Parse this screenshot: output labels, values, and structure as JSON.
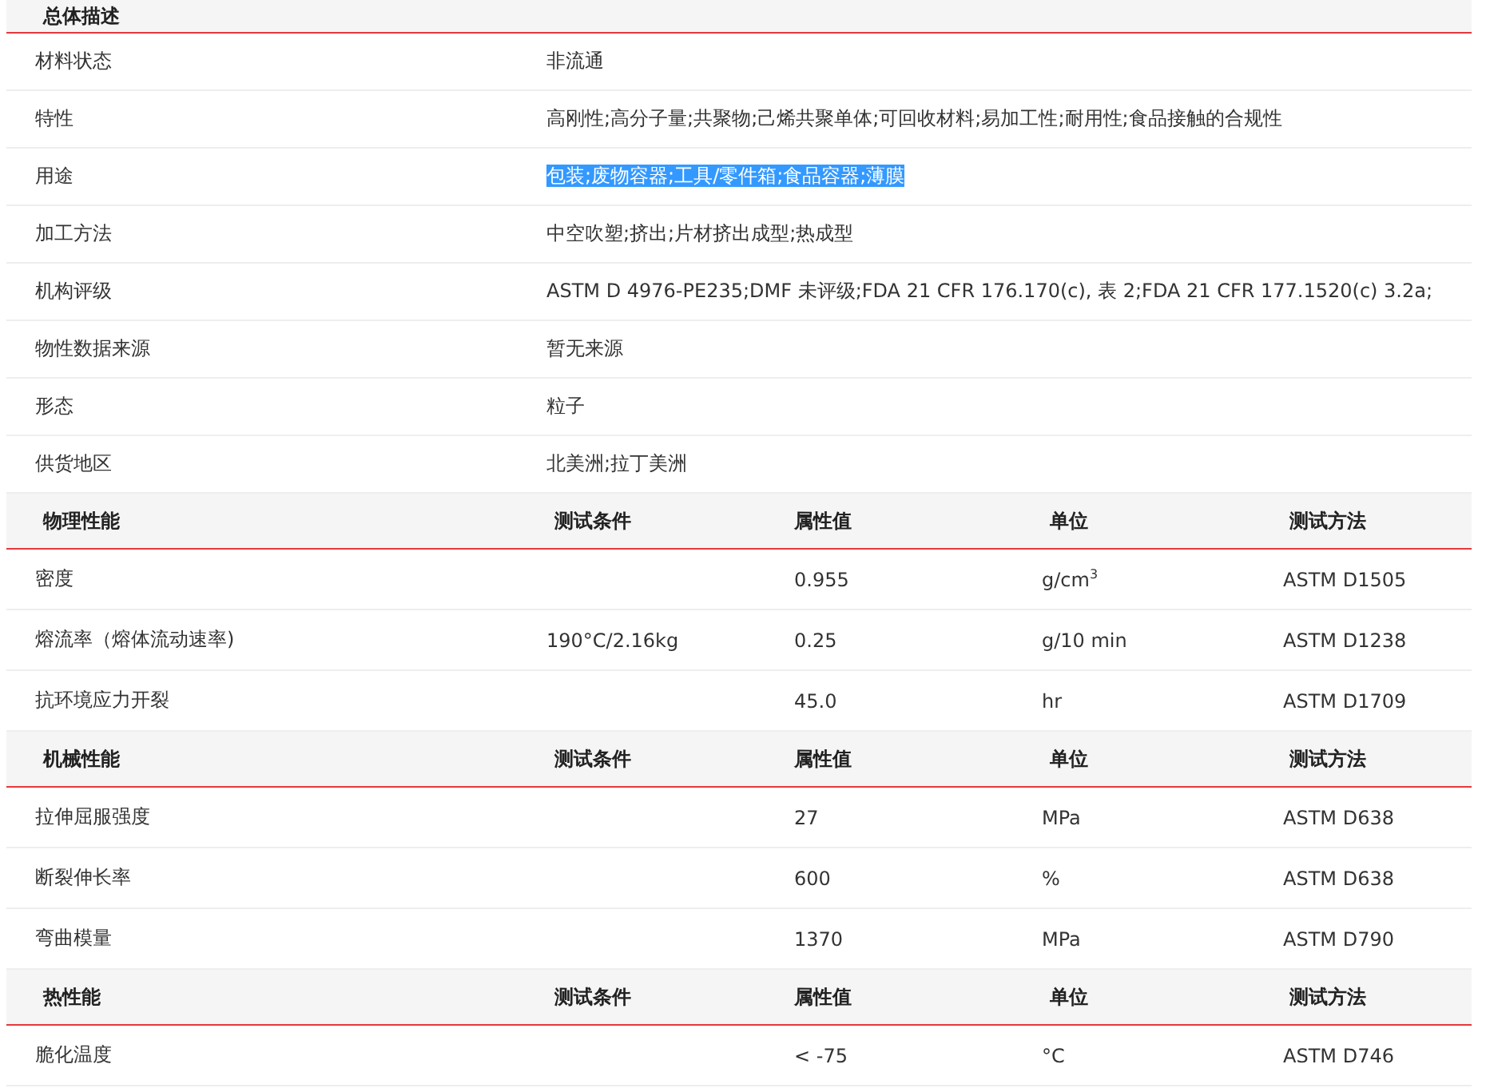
{
  "overview": {
    "title": "总体描述",
    "rows": [
      {
        "label": "材料状态",
        "value": "非流通",
        "highlighted": false
      },
      {
        "label": "特性",
        "value": "高刚性;高分子量;共聚物;己烯共聚单体;可回收材料;易加工性;耐用性;食品接触的合规性",
        "highlighted": false
      },
      {
        "label": "用途",
        "value": "包装;废物容器;工具/零件箱;食品容器;薄膜",
        "highlighted": true
      },
      {
        "label": "加工方法",
        "value": "中空吹塑;挤出;片材挤出成型;热成型",
        "highlighted": false
      },
      {
        "label": "机构评级",
        "value": "ASTM D 4976-PE235;DMF 未评级;FDA 21 CFR 176.170(c), 表 2;FDA 21 CFR 177.1520(c) 3.2a;",
        "highlighted": false
      },
      {
        "label": "物性数据来源",
        "value": "暂无来源",
        "highlighted": false
      },
      {
        "label": "形态",
        "value": "粒子",
        "highlighted": false
      },
      {
        "label": "供货地区",
        "value": "北美洲;拉丁美洲",
        "highlighted": false
      }
    ]
  },
  "property_sections": [
    {
      "columns": [
        "物理性能",
        "测试条件",
        "属性值",
        "单位",
        "测试方法"
      ],
      "rows": [
        [
          "密度",
          "",
          "0.955",
          "g/cm$^{3}$",
          "ASTM D1505"
        ],
        [
          "熔流率（熔体流动速率)",
          "190°C/2.16kg",
          "0.25",
          "g/10 min",
          "ASTM D1238"
        ],
        [
          "抗环境应力开裂",
          "",
          "45.0",
          "hr",
          "ASTM D1709"
        ]
      ]
    },
    {
      "columns": [
        "机械性能",
        "测试条件",
        "属性值",
        "单位",
        "测试方法"
      ],
      "rows": [
        [
          "拉伸屈服强度",
          "",
          "27",
          "MPa",
          "ASTM D638"
        ],
        [
          "断裂伸长率",
          "",
          "600",
          "%",
          "ASTM D638"
        ],
        [
          "弯曲模量",
          "",
          "1370",
          "MPa",
          "ASTM D790"
        ]
      ]
    },
    {
      "columns": [
        "热性能",
        "测试条件",
        "属性值",
        "单位",
        "测试方法"
      ],
      "rows": [
        [
          "脆化温度",
          "",
          "< -75",
          "°C",
          "ASTM D746"
        ]
      ]
    }
  ]
}
